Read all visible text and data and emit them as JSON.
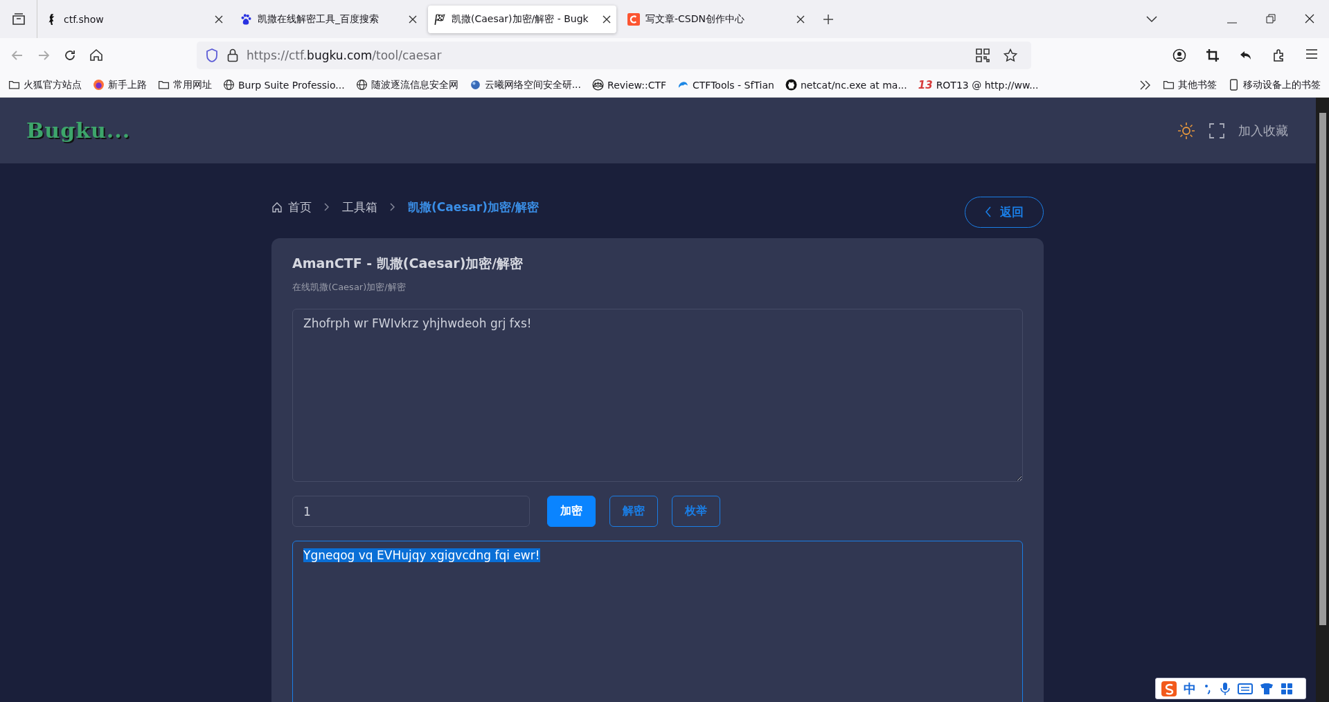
{
  "tabs": [
    {
      "label": "ctf.show",
      "kind": "figure",
      "selected": false
    },
    {
      "label": "凯撒在线解密工具_百度搜索",
      "kind": "paw",
      "selected": false
    },
    {
      "label": "凯撒(Caesar)加密/解密 - Bugk",
      "kind": "flag",
      "selected": true
    },
    {
      "label": "写文章-CSDN创作中心",
      "kind": "letter",
      "selected": false
    }
  ],
  "address": {
    "prefix": "https://ctf.",
    "domain": "bugku.com",
    "path": "/tool/caesar"
  },
  "bookmarks": [
    {
      "label": "火狐官方站点",
      "kind": "folder"
    },
    {
      "label": "新手上路",
      "kind": "firefox"
    },
    {
      "label": "常用网址",
      "kind": "folder"
    },
    {
      "label": "Burp Suite Professio...",
      "kind": "globe"
    },
    {
      "label": "随波逐流信息安全网",
      "kind": "globe"
    },
    {
      "label": "云曦网络空间安全研...",
      "kind": "orb"
    },
    {
      "label": "Review::CTF",
      "kind": "scales"
    },
    {
      "label": "CTFTools - SfTian",
      "kind": "cloud"
    },
    {
      "label": "netcat/nc.exe at ma...",
      "kind": "github"
    },
    {
      "label": "ROT13 @ http://ww...",
      "kind": "number",
      "badge": "13"
    }
  ],
  "bookmarks_right": [
    {
      "label": "其他书签",
      "kind": "folder"
    },
    {
      "label": "移动设备上的书签",
      "kind": "phone"
    }
  ],
  "site": {
    "logo": "Bugku...",
    "favorite": "加入收藏"
  },
  "breadcrumb": [
    {
      "label": "首页",
      "current": false
    },
    {
      "label": "工具箱",
      "current": false
    },
    {
      "label": "凯撒(Caesar)加密/解密",
      "current": true
    }
  ],
  "back_button": "返回",
  "card": {
    "title": "AmanCTF - 凯撒(Caesar)加密/解密",
    "subtitle": "在线凯撒(Caesar)加密/解密",
    "input_text": "Zhofrph wr FWIvkrz yhjhwdeoh grj fxs!",
    "shift": "1",
    "buttons": [
      {
        "label": "加密",
        "primary": true
      },
      {
        "label": "解密",
        "primary": false
      },
      {
        "label": "枚举",
        "primary": false
      }
    ],
    "output_text": "Ygneqog vq EVHujqy xgigvcdng fqi ewr!",
    "output_selected": true
  },
  "ime": {
    "mode": "中"
  }
}
